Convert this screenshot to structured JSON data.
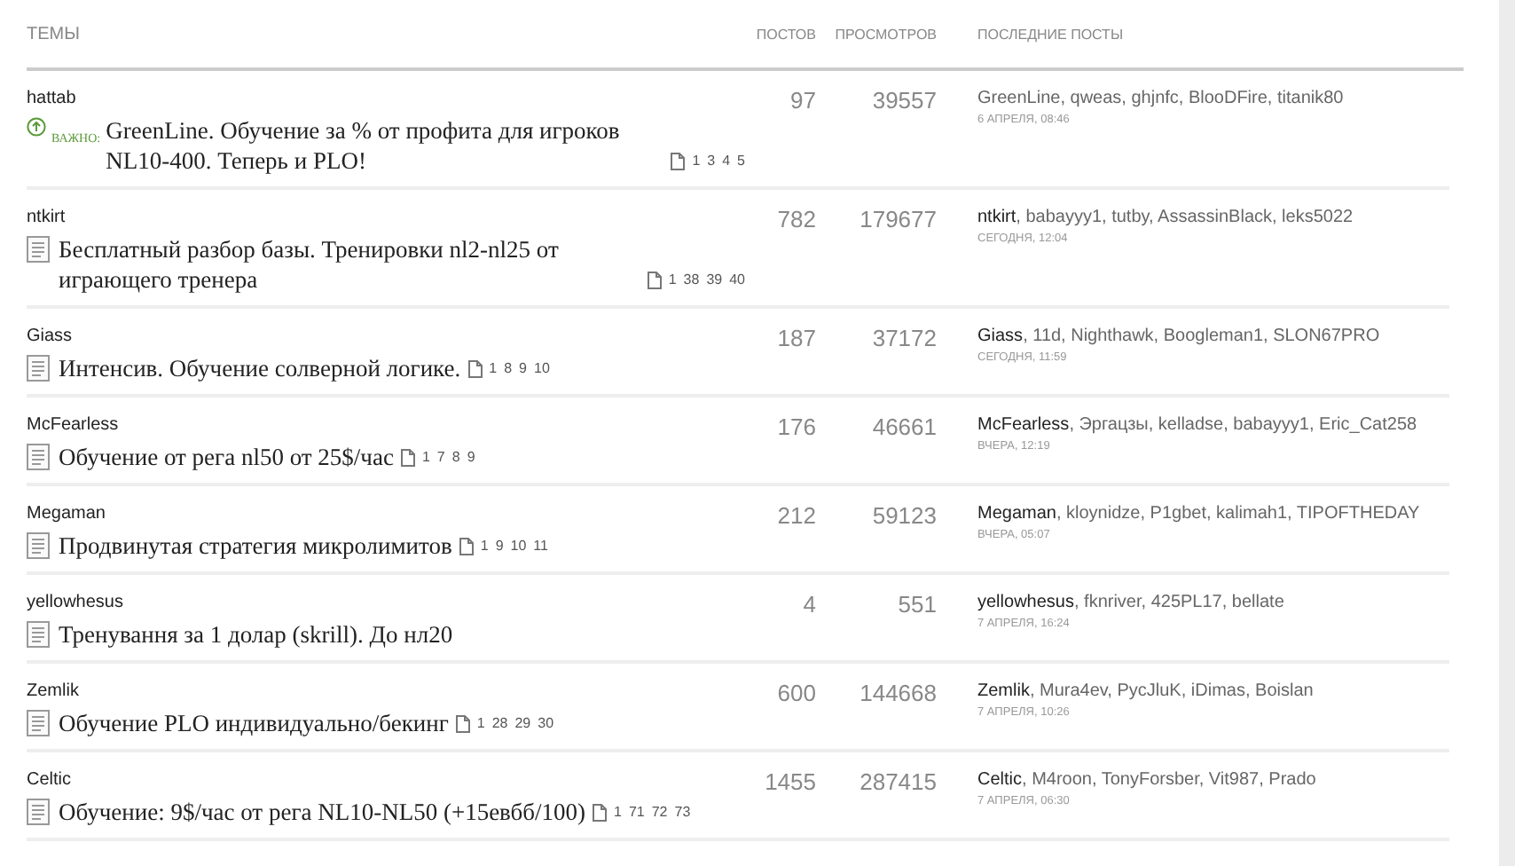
{
  "columns": [
    "ТЕМЫ",
    "ПОСТОВ",
    "ПРОСМОТРОВ",
    "ПОСЛЕДНИЕ ПОСТЫ"
  ],
  "topics": [
    {
      "kind": "important",
      "badge": "ВАЖНО:",
      "author": "hattab",
      "title": "GreenLine. Обучение за % от профита для игроков NL10-400. Теперь и PLO!",
      "pages": [
        "1",
        "3",
        "4",
        "5"
      ],
      "posts": "97",
      "views": "39557",
      "last_posters": "GreenLine, qweas, ghjnfc, BlooDFire, titanik80",
      "last_time": "6 АПРЕЛЯ, 08:46"
    },
    {
      "kind": "normal",
      "author": "ntkirt",
      "title": "Бесплатный разбор базы. Тренировки nl2-nl25 от играющего тренера",
      "pages": [
        "1",
        "38",
        "39",
        "40"
      ],
      "posts": "782",
      "views": "179677",
      "last_posters": "**ntkirt**, babayyy1, tutby, AssassinBlack, leks5022",
      "last_time": "СЕГОДНЯ, 12:04"
    },
    {
      "kind": "normal",
      "author": "Giass",
      "title": "Интенсив. Обучение солверной логике.",
      "pages": [
        "1",
        "8",
        "9",
        "10"
      ],
      "posts": "187",
      "views": "37172",
      "last_posters": "**Giass**, 11d, Nighthawk, Boogleman1, SLON67PRO",
      "last_time": "СЕГОДНЯ, 11:59"
    },
    {
      "kind": "normal",
      "author": "McFearless",
      "title": "Обучение от рега nl50 от 25$/час",
      "pages": [
        "1",
        "7",
        "8",
        "9"
      ],
      "posts": "176",
      "views": "46661",
      "last_posters": "**McFearless**, Эргацзы, kelladse, babayyy1, Eric_Cat258",
      "last_time": "ВЧЕРА, 12:19"
    },
    {
      "kind": "normal",
      "author": "Megaman",
      "title": "Продвинутая стратегия микролимитов",
      "pages": [
        "1",
        "9",
        "10",
        "11"
      ],
      "posts": "212",
      "views": "59123",
      "last_posters": "**Megaman**, kloynidze, P1gbet, kalimah1, TIPOFTHEDAY",
      "last_time": "ВЧЕРА, 05:07"
    },
    {
      "kind": "normal",
      "author": "yellowhesus",
      "title": "Тренування за 1 долар (skrill). До нл20",
      "posts": "4",
      "views": "551",
      "last_posters": "**yellowhesus**, fknriver, 425PL17, bellate",
      "last_time": "7 АПРЕЛЯ, 16:24"
    },
    {
      "kind": "normal",
      "author": "Zemlik",
      "title": "Обучение PLO индивидуально/бекинг",
      "pages": [
        "1",
        "28",
        "29",
        "30"
      ],
      "posts": "600",
      "views": "144668",
      "last_posters": "**Zemlik**, Mura4ev, PycJluK, iDimas, Boislan",
      "last_time": "7 АПРЕЛЯ, 10:26"
    },
    {
      "kind": "normal",
      "author": "Celtic",
      "title": "Обучение: 9$/час от рега NL10-NL50 (+15евбб/100)",
      "pages": [
        "1",
        "71",
        "72",
        "73"
      ],
      "posts": "1455",
      "views": "287415",
      "last_posters": "**Celtic**, M4roon, TonyForsber, Vit987, Prado",
      "last_time": "7 АПРЕЛЯ, 06:30"
    }
  ]
}
